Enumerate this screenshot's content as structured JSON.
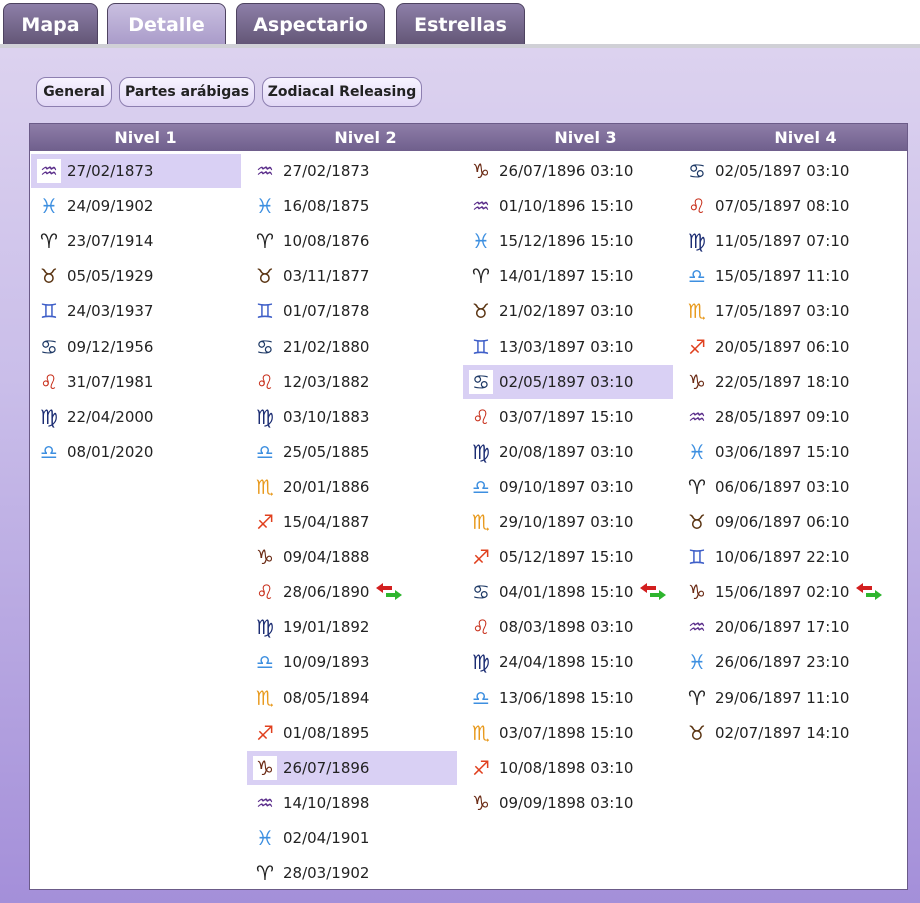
{
  "tabs": [
    {
      "label": "Mapa",
      "active": false
    },
    {
      "label": "Detalle",
      "active": true
    },
    {
      "label": "Aspectario",
      "active": false
    },
    {
      "label": "Estrellas",
      "active": false
    }
  ],
  "subtabs": [
    "General",
    "Partes arábigas",
    "Zodiacal Releasing"
  ],
  "headers": [
    "Nivel 1",
    "Nivel 2",
    "Nivel 3",
    "Nivel 4"
  ],
  "signs": {
    "aquarius": {
      "glyph": "♒",
      "color": "#5a2d8a"
    },
    "pisces": {
      "glyph": "♓",
      "color": "#3d8fe0"
    },
    "aries": {
      "glyph": "♈",
      "color": "#222222"
    },
    "taurus": {
      "glyph": "♉",
      "color": "#5a3412"
    },
    "gemini": {
      "glyph": "♊",
      "color": "#3f5fc8"
    },
    "cancer": {
      "glyph": "♋",
      "color": "#1f3a66"
    },
    "leo": {
      "glyph": "♌",
      "color": "#c8321e"
    },
    "virgo": {
      "glyph": "♍",
      "color": "#1c2d73"
    },
    "libra": {
      "glyph": "♎",
      "color": "#3d8fe0"
    },
    "scorpio": {
      "glyph": "♏",
      "color": "#e89a1e"
    },
    "sagittarius": {
      "glyph": "♐",
      "color": "#e0401e"
    },
    "capricorn": {
      "glyph": "♑",
      "color": "#6a2a14"
    }
  },
  "columns": [
    [
      {
        "sign": "aquarius",
        "date": "27/02/1873",
        "selected": true
      },
      {
        "sign": "pisces",
        "date": "24/09/1902"
      },
      {
        "sign": "aries",
        "date": "23/07/1914"
      },
      {
        "sign": "taurus",
        "date": "05/05/1929"
      },
      {
        "sign": "gemini",
        "date": "24/03/1937"
      },
      {
        "sign": "cancer",
        "date": "09/12/1956"
      },
      {
        "sign": "leo",
        "date": "31/07/1981"
      },
      {
        "sign": "virgo",
        "date": "22/04/2000"
      },
      {
        "sign": "libra",
        "date": "08/01/2020"
      }
    ],
    [
      {
        "sign": "aquarius",
        "date": "27/02/1873"
      },
      {
        "sign": "pisces",
        "date": "16/08/1875"
      },
      {
        "sign": "aries",
        "date": "10/08/1876"
      },
      {
        "sign": "taurus",
        "date": "03/11/1877"
      },
      {
        "sign": "gemini",
        "date": "01/07/1878"
      },
      {
        "sign": "cancer",
        "date": "21/02/1880"
      },
      {
        "sign": "leo",
        "date": "12/03/1882"
      },
      {
        "sign": "virgo",
        "date": "03/10/1883"
      },
      {
        "sign": "libra",
        "date": "25/05/1885"
      },
      {
        "sign": "scorpio",
        "date": "20/01/1886"
      },
      {
        "sign": "sagittarius",
        "date": "15/04/1887"
      },
      {
        "sign": "capricorn",
        "date": "09/04/1888"
      },
      {
        "sign": "leo",
        "date": "28/06/1890",
        "arrows": true
      },
      {
        "sign": "virgo",
        "date": "19/01/1892"
      },
      {
        "sign": "libra",
        "date": "10/09/1893"
      },
      {
        "sign": "scorpio",
        "date": "08/05/1894"
      },
      {
        "sign": "sagittarius",
        "date": "01/08/1895"
      },
      {
        "sign": "capricorn",
        "date": "26/07/1896",
        "selected": true
      },
      {
        "sign": "aquarius",
        "date": "14/10/1898"
      },
      {
        "sign": "pisces",
        "date": "02/04/1901"
      },
      {
        "sign": "aries",
        "date": "28/03/1902"
      }
    ],
    [
      {
        "sign": "capricorn",
        "date": "26/07/1896 03:10"
      },
      {
        "sign": "aquarius",
        "date": "01/10/1896 15:10"
      },
      {
        "sign": "pisces",
        "date": "15/12/1896 15:10"
      },
      {
        "sign": "aries",
        "date": "14/01/1897 15:10"
      },
      {
        "sign": "taurus",
        "date": "21/02/1897 03:10"
      },
      {
        "sign": "gemini",
        "date": "13/03/1897 03:10"
      },
      {
        "sign": "cancer",
        "date": "02/05/1897 03:10",
        "selected": true
      },
      {
        "sign": "leo",
        "date": "03/07/1897 15:10"
      },
      {
        "sign": "virgo",
        "date": "20/08/1897 03:10"
      },
      {
        "sign": "libra",
        "date": "09/10/1897 03:10"
      },
      {
        "sign": "scorpio",
        "date": "29/10/1897 03:10"
      },
      {
        "sign": "sagittarius",
        "date": "05/12/1897 15:10"
      },
      {
        "sign": "cancer",
        "date": "04/01/1898 15:10",
        "arrows": true
      },
      {
        "sign": "leo",
        "date": "08/03/1898 03:10"
      },
      {
        "sign": "virgo",
        "date": "24/04/1898 15:10"
      },
      {
        "sign": "libra",
        "date": "13/06/1898 15:10"
      },
      {
        "sign": "scorpio",
        "date": "03/07/1898 15:10"
      },
      {
        "sign": "sagittarius",
        "date": "10/08/1898 03:10"
      },
      {
        "sign": "capricorn",
        "date": "09/09/1898 03:10"
      }
    ],
    [
      {
        "sign": "cancer",
        "date": "02/05/1897 03:10"
      },
      {
        "sign": "leo",
        "date": "07/05/1897 08:10"
      },
      {
        "sign": "virgo",
        "date": "11/05/1897 07:10"
      },
      {
        "sign": "libra",
        "date": "15/05/1897 11:10"
      },
      {
        "sign": "scorpio",
        "date": "17/05/1897 03:10"
      },
      {
        "sign": "sagittarius",
        "date": "20/05/1897 06:10"
      },
      {
        "sign": "capricorn",
        "date": "22/05/1897 18:10"
      },
      {
        "sign": "aquarius",
        "date": "28/05/1897 09:10"
      },
      {
        "sign": "pisces",
        "date": "03/06/1897 15:10"
      },
      {
        "sign": "aries",
        "date": "06/06/1897 03:10"
      },
      {
        "sign": "taurus",
        "date": "09/06/1897 06:10"
      },
      {
        "sign": "gemini",
        "date": "10/06/1897 22:10"
      },
      {
        "sign": "capricorn",
        "date": "15/06/1897 02:10",
        "arrows": true
      },
      {
        "sign": "aquarius",
        "date": "20/06/1897 17:10"
      },
      {
        "sign": "pisces",
        "date": "26/06/1897 23:10"
      },
      {
        "sign": "aries",
        "date": "29/06/1897 11:10"
      },
      {
        "sign": "taurus",
        "date": "02/07/1897 14:10"
      }
    ]
  ]
}
